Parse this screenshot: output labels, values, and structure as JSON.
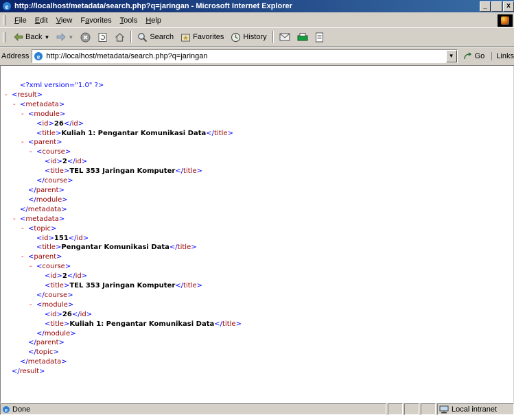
{
  "window": {
    "title": "http://localhost/metadata/search.php?q=jaringan - Microsoft Internet Explorer",
    "controls": {
      "minimize": "_",
      "maximize": " ",
      "close": "x"
    }
  },
  "menu": [
    "File",
    "Edit",
    "View",
    "Favorites",
    "Tools",
    "Help"
  ],
  "toolbar": {
    "back": "Back",
    "search": "Search",
    "favorites": "Favorites",
    "history": "History"
  },
  "address": {
    "label": "Address",
    "url": "http://localhost/metadata/search.php?q=jaringan",
    "go": "Go",
    "links": "Links"
  },
  "xml_lines": [
    {
      "indent": 1,
      "marker": "",
      "segments": [
        {
          "t": "<?xml version=\"1.0\" ?>",
          "c": "bl"
        }
      ]
    },
    {
      "indent": 0,
      "marker": "-",
      "segments": [
        {
          "t": "<",
          "c": "bl"
        },
        {
          "t": "result",
          "c": "br"
        },
        {
          "t": ">",
          "c": "bl"
        }
      ]
    },
    {
      "indent": 1,
      "marker": "-",
      "segments": [
        {
          "t": "<",
          "c": "bl"
        },
        {
          "t": "metadata",
          "c": "br"
        },
        {
          "t": ">",
          "c": "bl"
        }
      ]
    },
    {
      "indent": 2,
      "marker": "-",
      "segments": [
        {
          "t": "<",
          "c": "bl"
        },
        {
          "t": "module",
          "c": "br"
        },
        {
          "t": ">",
          "c": "bl"
        }
      ]
    },
    {
      "indent": 3,
      "marker": "",
      "segments": [
        {
          "t": "<",
          "c": "bl"
        },
        {
          "t": "id",
          "c": "br"
        },
        {
          "t": ">",
          "c": "bl"
        },
        {
          "t": "26",
          "c": "vl"
        },
        {
          "t": "</",
          "c": "bl"
        },
        {
          "t": "id",
          "c": "br"
        },
        {
          "t": ">",
          "c": "bl"
        }
      ]
    },
    {
      "indent": 3,
      "marker": "",
      "segments": [
        {
          "t": "<",
          "c": "bl"
        },
        {
          "t": "title",
          "c": "br"
        },
        {
          "t": ">",
          "c": "bl"
        },
        {
          "t": "Kuliah 1: Pengantar Komunikasi Data",
          "c": "vl"
        },
        {
          "t": "</",
          "c": "bl"
        },
        {
          "t": "title",
          "c": "br"
        },
        {
          "t": ">",
          "c": "bl"
        }
      ]
    },
    {
      "indent": 2,
      "marker": "-",
      "segments": [
        {
          "t": "<",
          "c": "bl"
        },
        {
          "t": "parent",
          "c": "br"
        },
        {
          "t": ">",
          "c": "bl"
        }
      ]
    },
    {
      "indent": 3,
      "marker": "-",
      "segments": [
        {
          "t": "<",
          "c": "bl"
        },
        {
          "t": "course",
          "c": "br"
        },
        {
          "t": ">",
          "c": "bl"
        }
      ]
    },
    {
      "indent": 4,
      "marker": "",
      "segments": [
        {
          "t": "<",
          "c": "bl"
        },
        {
          "t": "id",
          "c": "br"
        },
        {
          "t": ">",
          "c": "bl"
        },
        {
          "t": "2",
          "c": "vl"
        },
        {
          "t": "</",
          "c": "bl"
        },
        {
          "t": "id",
          "c": "br"
        },
        {
          "t": ">",
          "c": "bl"
        }
      ]
    },
    {
      "indent": 4,
      "marker": "",
      "segments": [
        {
          "t": "<",
          "c": "bl"
        },
        {
          "t": "title",
          "c": "br"
        },
        {
          "t": ">",
          "c": "bl"
        },
        {
          "t": "TEL 353 Jaringan Komputer",
          "c": "vl"
        },
        {
          "t": "</",
          "c": "bl"
        },
        {
          "t": "title",
          "c": "br"
        },
        {
          "t": ">",
          "c": "bl"
        }
      ]
    },
    {
      "indent": 3,
      "marker": "",
      "segments": [
        {
          "t": "</",
          "c": "bl"
        },
        {
          "t": "course",
          "c": "br"
        },
        {
          "t": ">",
          "c": "bl"
        }
      ]
    },
    {
      "indent": 2,
      "marker": "",
      "segments": [
        {
          "t": "</",
          "c": "bl"
        },
        {
          "t": "parent",
          "c": "br"
        },
        {
          "t": ">",
          "c": "bl"
        }
      ]
    },
    {
      "indent": 2,
      "marker": "",
      "segments": [
        {
          "t": "</",
          "c": "bl"
        },
        {
          "t": "module",
          "c": "br"
        },
        {
          "t": ">",
          "c": "bl"
        }
      ]
    },
    {
      "indent": 1,
      "marker": "",
      "segments": [
        {
          "t": "</",
          "c": "bl"
        },
        {
          "t": "metadata",
          "c": "br"
        },
        {
          "t": ">",
          "c": "bl"
        }
      ]
    },
    {
      "indent": 1,
      "marker": "-",
      "segments": [
        {
          "t": "<",
          "c": "bl"
        },
        {
          "t": "metadata",
          "c": "br"
        },
        {
          "t": ">",
          "c": "bl"
        }
      ]
    },
    {
      "indent": 2,
      "marker": "-",
      "segments": [
        {
          "t": "<",
          "c": "bl"
        },
        {
          "t": "topic",
          "c": "br"
        },
        {
          "t": ">",
          "c": "bl"
        }
      ]
    },
    {
      "indent": 3,
      "marker": "",
      "segments": [
        {
          "t": "<",
          "c": "bl"
        },
        {
          "t": "id",
          "c": "br"
        },
        {
          "t": ">",
          "c": "bl"
        },
        {
          "t": "151",
          "c": "vl"
        },
        {
          "t": "</",
          "c": "bl"
        },
        {
          "t": "id",
          "c": "br"
        },
        {
          "t": ">",
          "c": "bl"
        }
      ]
    },
    {
      "indent": 3,
      "marker": "",
      "segments": [
        {
          "t": "<",
          "c": "bl"
        },
        {
          "t": "title",
          "c": "br"
        },
        {
          "t": ">",
          "c": "bl"
        },
        {
          "t": "Pengantar Komunikasi Data",
          "c": "vl"
        },
        {
          "t": "</",
          "c": "bl"
        },
        {
          "t": "title",
          "c": "br"
        },
        {
          "t": ">",
          "c": "bl"
        }
      ]
    },
    {
      "indent": 2,
      "marker": "-",
      "segments": [
        {
          "t": "<",
          "c": "bl"
        },
        {
          "t": "parent",
          "c": "br"
        },
        {
          "t": ">",
          "c": "bl"
        }
      ]
    },
    {
      "indent": 3,
      "marker": "-",
      "segments": [
        {
          "t": "<",
          "c": "bl"
        },
        {
          "t": "course",
          "c": "br"
        },
        {
          "t": ">",
          "c": "bl"
        }
      ]
    },
    {
      "indent": 4,
      "marker": "",
      "segments": [
        {
          "t": "<",
          "c": "bl"
        },
        {
          "t": "id",
          "c": "br"
        },
        {
          "t": ">",
          "c": "bl"
        },
        {
          "t": "2",
          "c": "vl"
        },
        {
          "t": "</",
          "c": "bl"
        },
        {
          "t": "id",
          "c": "br"
        },
        {
          "t": ">",
          "c": "bl"
        }
      ]
    },
    {
      "indent": 4,
      "marker": "",
      "segments": [
        {
          "t": "<",
          "c": "bl"
        },
        {
          "t": "title",
          "c": "br"
        },
        {
          "t": ">",
          "c": "bl"
        },
        {
          "t": "TEL 353 Jaringan Komputer",
          "c": "vl"
        },
        {
          "t": "</",
          "c": "bl"
        },
        {
          "t": "title",
          "c": "br"
        },
        {
          "t": ">",
          "c": "bl"
        }
      ]
    },
    {
      "indent": 3,
      "marker": "",
      "segments": [
        {
          "t": "</",
          "c": "bl"
        },
        {
          "t": "course",
          "c": "br"
        },
        {
          "t": ">",
          "c": "bl"
        }
      ]
    },
    {
      "indent": 3,
      "marker": "-",
      "segments": [
        {
          "t": "<",
          "c": "bl"
        },
        {
          "t": "module",
          "c": "br"
        },
        {
          "t": ">",
          "c": "bl"
        }
      ]
    },
    {
      "indent": 4,
      "marker": "",
      "segments": [
        {
          "t": "<",
          "c": "bl"
        },
        {
          "t": "id",
          "c": "br"
        },
        {
          "t": ">",
          "c": "bl"
        },
        {
          "t": "26",
          "c": "vl"
        },
        {
          "t": "</",
          "c": "bl"
        },
        {
          "t": "id",
          "c": "br"
        },
        {
          "t": ">",
          "c": "bl"
        }
      ]
    },
    {
      "indent": 4,
      "marker": "",
      "segments": [
        {
          "t": "<",
          "c": "bl"
        },
        {
          "t": "title",
          "c": "br"
        },
        {
          "t": ">",
          "c": "bl"
        },
        {
          "t": "Kuliah 1: Pengantar Komunikasi Data",
          "c": "vl"
        },
        {
          "t": "</",
          "c": "bl"
        },
        {
          "t": "title",
          "c": "br"
        },
        {
          "t": ">",
          "c": "bl"
        }
      ]
    },
    {
      "indent": 3,
      "marker": "",
      "segments": [
        {
          "t": "</",
          "c": "bl"
        },
        {
          "t": "module",
          "c": "br"
        },
        {
          "t": ">",
          "c": "bl"
        }
      ]
    },
    {
      "indent": 2,
      "marker": "",
      "segments": [
        {
          "t": "</",
          "c": "bl"
        },
        {
          "t": "parent",
          "c": "br"
        },
        {
          "t": ">",
          "c": "bl"
        }
      ]
    },
    {
      "indent": 2,
      "marker": "",
      "segments": [
        {
          "t": "</",
          "c": "bl"
        },
        {
          "t": "topic",
          "c": "br"
        },
        {
          "t": ">",
          "c": "bl"
        }
      ]
    },
    {
      "indent": 1,
      "marker": "",
      "segments": [
        {
          "t": "</",
          "c": "bl"
        },
        {
          "t": "metadata",
          "c": "br"
        },
        {
          "t": ">",
          "c": "bl"
        }
      ]
    },
    {
      "indent": 0,
      "marker": "",
      "segments": [
        {
          "t": "</",
          "c": "bl"
        },
        {
          "t": "result",
          "c": "br"
        },
        {
          "t": ">",
          "c": "bl"
        }
      ]
    }
  ],
  "status": {
    "text": "Done",
    "zone": "Local intranet"
  },
  "colors": {
    "markup": "#0000ff",
    "tag_name": "#990000",
    "collapse_marker": "#ff0000",
    "titlebar": "#0a246a"
  }
}
